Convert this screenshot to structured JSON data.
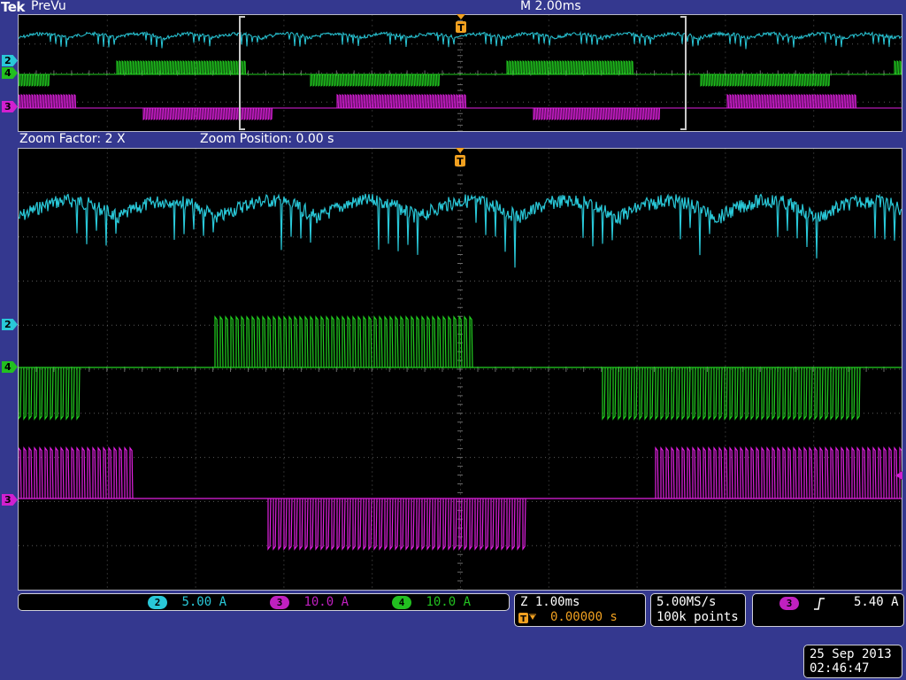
{
  "header": {
    "brand": "Tek",
    "mode": "PreVu",
    "timebase": "M 2.00ms"
  },
  "zoom": {
    "factor_label": "Zoom Factor: 2 X",
    "position_label": "Zoom Position: 0.00 s"
  },
  "markers": {
    "ch2": "2",
    "ch4": "4",
    "ch3": "3",
    "trigger": "T"
  },
  "colors": {
    "ch2": "#29c8d8",
    "ch3": "#e020e0",
    "ch4": "#22d020",
    "trigger": "#f0a020"
  },
  "channels": [
    {
      "num": "2",
      "scale": "5.00 A",
      "color": "#29c8d8"
    },
    {
      "num": "3",
      "scale": "10.0 A",
      "color": "#c020c0"
    },
    {
      "num": "4",
      "scale": "10.0 A",
      "color": "#22c020"
    }
  ],
  "horizontal": {
    "zoom_scale": "Z 1.00ms",
    "trigger_position": "0.00000 s"
  },
  "acquisition": {
    "sample_rate": "5.00MS/s",
    "record_length": "100k points"
  },
  "trigger": {
    "source": "3",
    "slope_icon": "rising-edge-icon",
    "level": "5.40 A"
  },
  "datetime": {
    "date": "25 Sep  2013",
    "time": "02:46:47"
  }
}
